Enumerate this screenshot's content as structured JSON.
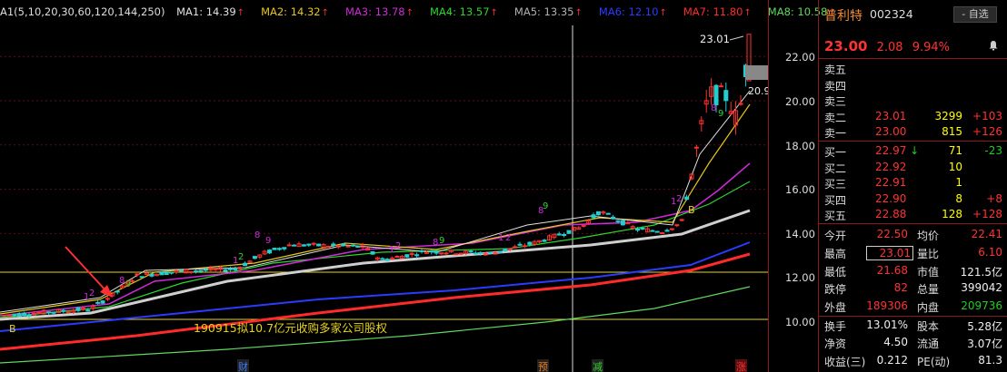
{
  "ma_legend": {
    "prefix": "A1(5,10,20,30,60,120,144,250)",
    "items": [
      {
        "label": "MA1: 14.39",
        "color": "#e0e0e0"
      },
      {
        "label": "MA2: 14.32",
        "color": "#e6c61a"
      },
      {
        "label": "MA3: 13.78",
        "color": "#d02ad8"
      },
      {
        "label": "MA4: 13.57",
        "color": "#2bd62b"
      },
      {
        "label": "MA5: 13.35",
        "color": "#b0b0b0"
      },
      {
        "label": "MA6: 12.10",
        "color": "#2b3bff"
      },
      {
        "label": "MA7: 11.80",
        "color": "#ff2a2a"
      },
      {
        "label": "MA8: 10.58",
        "color": "#5ed85e"
      }
    ],
    "up_arrow": "↑"
  },
  "axis_ticks": [
    "22.00",
    "20.00",
    "18.00",
    "16.00",
    "14.00",
    "12.00",
    "10.00"
  ],
  "chart_labels": {
    "high_label": "23.01",
    "low_label": "20.9",
    "announcement": "190915拟10.7亿元收购多家公司股权",
    "markers": [
      "财",
      "预",
      "减",
      "涨"
    ],
    "left_marker": "B",
    "mid_marker": "B"
  },
  "stock": {
    "name": "普利特",
    "code": "002324",
    "watch_button": "- 自选",
    "price": "23.00",
    "change": "2.08",
    "change_pct": "9.94%"
  },
  "asks": [
    {
      "label": "卖五",
      "price": "",
      "vol": "",
      "chg": ""
    },
    {
      "label": "卖四",
      "price": "",
      "vol": "",
      "chg": ""
    },
    {
      "label": "卖三",
      "price": "",
      "vol": "",
      "chg": ""
    },
    {
      "label": "卖二",
      "price": "23.01",
      "vol": "3299",
      "chg": "+103"
    },
    {
      "label": "卖一",
      "price": "23.00",
      "vol": "815",
      "chg": "+126"
    }
  ],
  "bids": [
    {
      "label": "买一",
      "price": "22.97",
      "arrow": "↓",
      "vol": "71",
      "chg": "-23"
    },
    {
      "label": "买二",
      "price": "22.92",
      "arrow": "",
      "vol": "10",
      "chg": ""
    },
    {
      "label": "买三",
      "price": "22.91",
      "arrow": "",
      "vol": "1",
      "chg": ""
    },
    {
      "label": "买四",
      "price": "22.90",
      "arrow": "",
      "vol": "8",
      "chg": "+8"
    },
    {
      "label": "买五",
      "price": "22.88",
      "arrow": "",
      "vol": "128",
      "chg": "+128"
    }
  ],
  "stats": [
    {
      "a": "今开",
      "b": "22.50",
      "bc": "red",
      "c": "均价",
      "d": "22.41",
      "dc": "red"
    },
    {
      "a": "最高",
      "b": "23.01",
      "bc": "red",
      "c": "量比",
      "d": "6.10",
      "dc": "red"
    },
    {
      "a": "最低",
      "b": "21.68",
      "bc": "red",
      "c": "市值",
      "d": "121.5亿",
      "dc": "white"
    },
    {
      "a": "跌停",
      "b": "82",
      "bc": "red",
      "c": "总量",
      "d": "399042",
      "dc": "white"
    },
    {
      "a": "外盘",
      "b": "189306",
      "bc": "red",
      "c": "内盘",
      "d": "209736",
      "dc": "green"
    },
    {
      "a": "换手",
      "b": "13.01%",
      "bc": "white",
      "c": "股本",
      "d": "5.28亿",
      "dc": "white"
    },
    {
      "a": "净资",
      "b": "4.50",
      "bc": "white",
      "c": "流通",
      "d": "3.07亿",
      "dc": "white"
    },
    {
      "a": "收益(三)",
      "b": "0.212",
      "bc": "white",
      "c": "PE(动)",
      "d": "81.3",
      "dc": "white"
    }
  ]
}
